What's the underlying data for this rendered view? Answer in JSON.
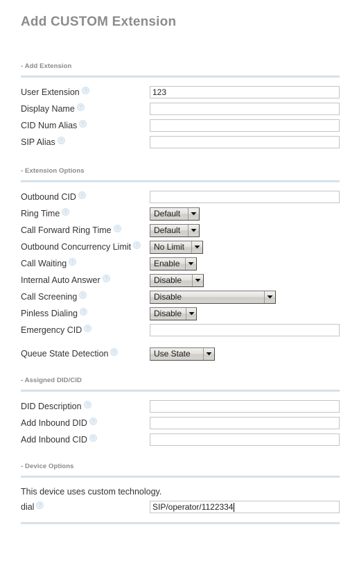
{
  "page": {
    "title": "Add CUSTOM Extension"
  },
  "icons": {
    "help": "help-icon",
    "dropdown_arrow": "chevron-down-icon"
  },
  "sections": [
    {
      "id": "add-extension",
      "header": "- Add Extension",
      "fields": [
        {
          "label": "User Extension",
          "type": "text",
          "value": "123",
          "placeholder": ""
        },
        {
          "label": "Display Name",
          "type": "text",
          "value": "",
          "placeholder": ""
        },
        {
          "label": "CID Num Alias",
          "type": "text",
          "value": "",
          "placeholder": ""
        },
        {
          "label": "SIP Alias",
          "type": "text",
          "value": "",
          "placeholder": ""
        }
      ]
    },
    {
      "id": "extension-options",
      "header": "- Extension Options",
      "fields": [
        {
          "label": "Outbound CID",
          "type": "text",
          "value": "",
          "placeholder": ""
        },
        {
          "label": "Ring Time",
          "type": "select",
          "value": "Default"
        },
        {
          "label": "Call Forward Ring Time",
          "type": "select",
          "value": "Default"
        },
        {
          "label": "Outbound Concurrency Limit",
          "type": "select",
          "value": "No Limit"
        },
        {
          "label": "Call Waiting",
          "type": "select",
          "value": "Enable"
        },
        {
          "label": "Internal Auto Answer",
          "type": "select",
          "value": "Disable"
        },
        {
          "label": "Call Screening",
          "type": "select",
          "value": "Disable"
        },
        {
          "label": "Pinless Dialing",
          "type": "select",
          "value": "Disable"
        },
        {
          "label": "Emergency CID",
          "type": "text",
          "value": "",
          "placeholder": ""
        },
        {
          "label": "Queue State Detection",
          "type": "select",
          "value": "Use State"
        }
      ]
    },
    {
      "id": "assigned-did-cid",
      "header": "- Assigned DID/CID",
      "fields": [
        {
          "label": "DID Description",
          "type": "text",
          "value": "",
          "placeholder": ""
        },
        {
          "label": "Add Inbound DID",
          "type": "text",
          "value": "",
          "placeholder": ""
        },
        {
          "label": "Add Inbound CID",
          "type": "text",
          "value": "",
          "placeholder": ""
        }
      ]
    },
    {
      "id": "device-options",
      "header": "- Device Options",
      "note": "This device uses custom technology.",
      "fields": [
        {
          "label": "dial",
          "type": "text",
          "value": "SIP/operator/1122334",
          "placeholder": ""
        }
      ]
    }
  ],
  "colors": {
    "title": "#8c8c8c",
    "section_header": "#8a8a8a",
    "rule": "#dbe5ed",
    "label": "#333333",
    "input_border": "#c4c4c4",
    "select_face": "#e2e0dc"
  }
}
